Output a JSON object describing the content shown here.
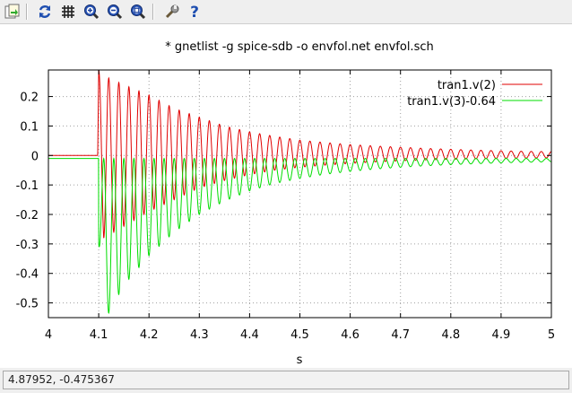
{
  "toolbar": {
    "buttons": [
      {
        "name": "export-icon",
        "kind": "export"
      },
      {
        "name": "refresh-icon",
        "kind": "refresh"
      },
      {
        "name": "grid-icon",
        "kind": "grid"
      },
      {
        "name": "zoom-in-icon",
        "kind": "zoomin"
      },
      {
        "name": "zoom-out-icon",
        "kind": "zoomout"
      },
      {
        "name": "zoom-fit-icon",
        "kind": "zoomfit"
      },
      {
        "name": "settings-wrench-icon",
        "kind": "wrench"
      },
      {
        "name": "help-icon",
        "kind": "help"
      }
    ]
  },
  "status": {
    "coords": "4.87952, -0.475367"
  },
  "chart_data": {
    "type": "line",
    "title": "* gnetlist -g spice-sdb -o envfol.net envfol.sch",
    "xlabel": "s",
    "ylabel": "",
    "xlim": [
      4,
      5
    ],
    "ylim": [
      -0.55,
      0.29
    ],
    "xticks": [
      "4",
      "4.1",
      "4.2",
      "4.3",
      "4.4",
      "4.5",
      "4.6",
      "4.7",
      "4.8",
      "4.9",
      "5"
    ],
    "yticks": [
      "0.2",
      "0.1",
      "0",
      "-0.1",
      "-0.2",
      "-0.3",
      "-0.4",
      "-0.5"
    ],
    "grid": true,
    "legend_position": "top-right",
    "series": [
      {
        "name": "tran1.v(2)",
        "color": "#e00000",
        "x": [
          4.0,
          4.098,
          4.1,
          4.11,
          4.15,
          4.2,
          4.25,
          4.3,
          4.35,
          4.4,
          4.45,
          4.5,
          4.55,
          4.6,
          4.65,
          4.7,
          4.75,
          4.8,
          4.85,
          4.9,
          4.95,
          5.0
        ],
        "upper": [
          0.0,
          0.0,
          0.29,
          0.27,
          0.24,
          0.205,
          0.16,
          0.13,
          0.1,
          0.08,
          0.065,
          0.052,
          0.044,
          0.037,
          0.032,
          0.028,
          0.024,
          0.021,
          0.018,
          0.016,
          0.014,
          0.013
        ],
        "lower": [
          0.0,
          0.0,
          -0.05,
          -0.28,
          -0.24,
          -0.19,
          -0.15,
          -0.11,
          -0.085,
          -0.065,
          -0.05,
          -0.04,
          -0.033,
          -0.027,
          -0.022,
          -0.018,
          -0.015,
          -0.013,
          -0.011,
          -0.01,
          -0.009,
          -0.008
        ]
      },
      {
        "name": "tran1.v(3)-0.64",
        "color": "#00dd00",
        "x": [
          4.0,
          4.098,
          4.1,
          4.115,
          4.15,
          4.2,
          4.25,
          4.3,
          4.35,
          4.4,
          4.45,
          4.5,
          4.55,
          4.6,
          4.65,
          4.7,
          4.75,
          4.8,
          4.85,
          4.9,
          4.95,
          5.0
        ],
        "upper": [
          -0.01,
          -0.01,
          -0.01,
          -0.01,
          -0.01,
          -0.01,
          -0.01,
          -0.01,
          -0.01,
          -0.01,
          -0.01,
          -0.01,
          -0.01,
          -0.01,
          -0.01,
          -0.01,
          -0.01,
          -0.01,
          -0.01,
          -0.01,
          -0.01,
          -0.01
        ],
        "lower": [
          -0.01,
          -0.01,
          -0.3,
          -0.55,
          -0.44,
          -0.34,
          -0.26,
          -0.2,
          -0.155,
          -0.12,
          -0.095,
          -0.078,
          -0.064,
          -0.054,
          -0.046,
          -0.04,
          -0.035,
          -0.031,
          -0.028,
          -0.025,
          -0.023,
          -0.021
        ]
      }
    ]
  }
}
